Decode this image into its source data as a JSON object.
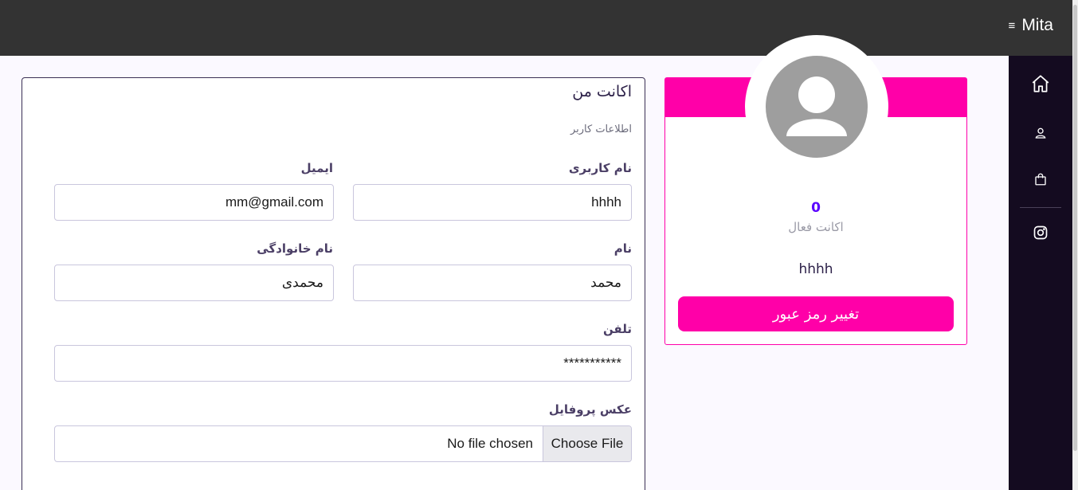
{
  "header": {
    "brand": "Mita",
    "menu_glyph": "≡",
    "background": "#333333"
  },
  "sidebar": {
    "items": [
      {
        "name": "home",
        "icon": "home-icon"
      },
      {
        "name": "profile",
        "icon": "user-icon"
      },
      {
        "name": "orders",
        "icon": "shopping-bag-icon"
      },
      {
        "name": "instagram",
        "icon": "instagram-icon"
      }
    ],
    "background": "#140b20"
  },
  "form": {
    "title": "اکانت من",
    "subtitle": "اطلاعات کاربر",
    "fields": {
      "username": {
        "label": "نام کاربری",
        "value": "hhhh"
      },
      "email": {
        "label": "ایمیل",
        "value": "mm@gmail.com"
      },
      "first_name": {
        "label": "نام",
        "value": "محمد"
      },
      "last_name": {
        "label": "نام خانوادگی",
        "value": "محمدی"
      },
      "phone": {
        "label": "تلفن",
        "value": "***********"
      },
      "profile_photo": {
        "label": "عکس پروفایل",
        "button": "Choose File",
        "status": "No file chosen"
      }
    }
  },
  "profile": {
    "stat_value": "0",
    "stat_label": "اکانت فعال",
    "username": "hhhh",
    "change_password_label": "تغییر رمز عبور",
    "accent": "#ff00a8"
  }
}
